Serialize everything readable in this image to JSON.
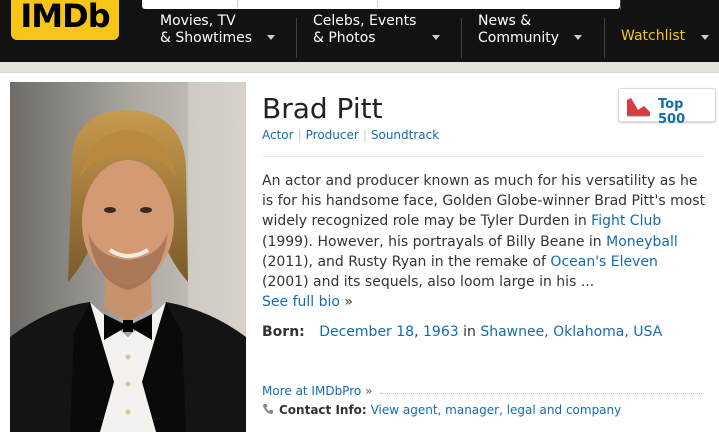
{
  "header": {
    "logo_text": "IMDb",
    "nav": [
      {
        "label": "Movies, TV\n& Showtimes"
      },
      {
        "label": "Celebs, Events\n& Photos"
      },
      {
        "label": "News &\nCommunity"
      }
    ],
    "watchlist_label": "Watchlist"
  },
  "person": {
    "name": "Brad Pitt",
    "professions": [
      "Actor",
      "Producer",
      "Soundtrack"
    ],
    "top_badge": "Top 500",
    "bio": {
      "part1": "An actor and producer known as much for his versatility as he is for his handsome face, Golden Globe-winner Brad Pitt's most widely recognized role may be Tyler Durden in ",
      "link1": "Fight Club",
      "part2": " (1999). However, his portrayals of Billy Beane in ",
      "link2": "Moneyball",
      "part3": " (2011), and Rusty Ryan in the remake of ",
      "link3": "Ocean's Eleven",
      "part4": " (2001) and its sequels, also loom large in his ...",
      "see_full": "See full bio",
      "see_full_arrow": "»"
    },
    "born": {
      "label": "Born:",
      "date": "December 18",
      "year": "1963",
      "in_word": "in",
      "place": "Shawnee, Oklahoma, USA"
    },
    "more_link": "More at IMDbPro",
    "more_arrow": "»",
    "contact_label": "Contact Info:",
    "contact_link": "View agent, manager, legal and company"
  },
  "colors": {
    "accent": "#f5c518",
    "link": "#136cb2",
    "header_bg": "#121212"
  }
}
